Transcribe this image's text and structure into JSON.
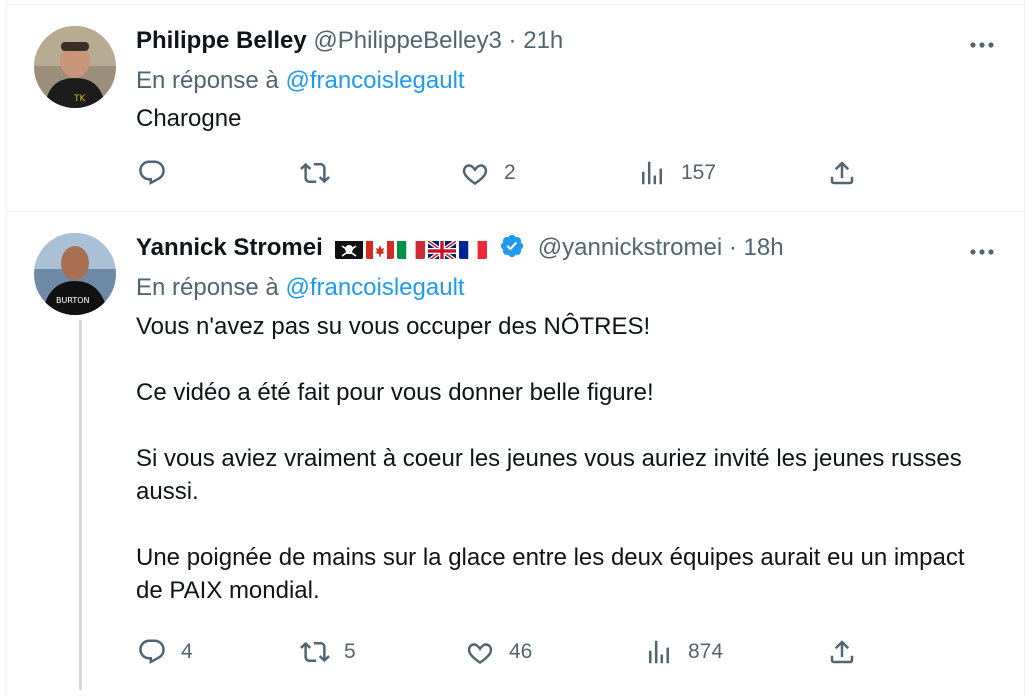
{
  "tweets": [
    {
      "author_name": "Philippe Belley",
      "handle": "@PhilippeBelley3",
      "separator": "·",
      "time": "21h",
      "reply_prefix": "En réponse à",
      "reply_mention": "@francoislegault",
      "text_paragraphs": [
        "Charogne"
      ],
      "actions": {
        "reply_count": "",
        "retweet_count": "",
        "like_count": "2",
        "views_count": "157"
      },
      "avatar_icon": "person-avatar"
    },
    {
      "author_name": "Yannick Stromei",
      "flags": [
        "pirate-flag",
        "canada-flag",
        "italy-flag",
        "uk-flag",
        "france-flag"
      ],
      "verified": true,
      "handle": "@yannickstromei",
      "separator": "·",
      "time": "18h",
      "reply_prefix": "En réponse à",
      "reply_mention": "@francoislegault",
      "text_paragraphs": [
        "Vous n'avez pas su vous occuper des NÔTRES!",
        "Ce vidéo a été fait pour vous donner belle figure!",
        "Si vous aviez vraiment à coeur les jeunes vous auriez invité les jeunes russes aussi.",
        "Une poignée de mains sur la glace entre les deux équipes aurait eu un impact de PAIX mondial."
      ],
      "actions": {
        "reply_count": "4",
        "retweet_count": "5",
        "like_count": "46",
        "views_count": "874"
      },
      "avatar_icon": "person-avatar"
    }
  ],
  "icons": {
    "reply": "reply-icon",
    "retweet": "retweet-icon",
    "like": "heart-icon",
    "views": "views-icon",
    "share": "share-icon",
    "more": "more-options-icon"
  },
  "colors": {
    "text": "#0f1419",
    "secondary": "#536471",
    "link": "#1d9bf0",
    "divider": "#eff3f4",
    "thread_line": "#cfd9de"
  }
}
